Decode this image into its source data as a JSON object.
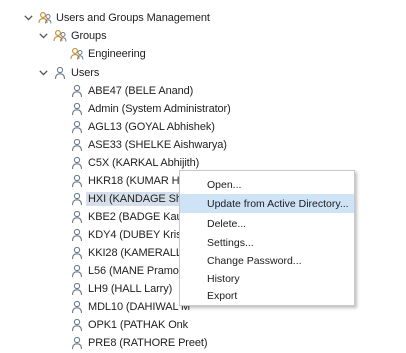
{
  "tree": {
    "root": {
      "label": "Users and Groups Management",
      "icon": "users-groups-icon",
      "expanded": true
    },
    "groups": {
      "label": "Groups",
      "icon": "group-icon",
      "expanded": true
    },
    "group_items": [
      {
        "label": "Engineering",
        "icon": "group-icon"
      }
    ],
    "users": {
      "label": "Users",
      "icon": "user-icon",
      "expanded": true
    },
    "user_items": [
      {
        "label": "ABE47 (BELE Anand)"
      },
      {
        "label": "Admin (System Administrator)"
      },
      {
        "label": "AGL13 (GOYAL Abhishek)"
      },
      {
        "label": "ASE33 (SHELKE Aishwarya)"
      },
      {
        "label": "C5X (KARKAL Abhijith)"
      },
      {
        "label": "HKR18 (KUMAR Himanshu)"
      },
      {
        "label": "HXI (KANDAGE Shail",
        "selected": true
      },
      {
        "label": "KBE2 (BADGE Kaustu"
      },
      {
        "label": "KDY4 (DUBEY Krishn"
      },
      {
        "label": "KKI28 (KAMERALLI K"
      },
      {
        "label": "L56 (MANE Pramod)"
      },
      {
        "label": "LH9 (HALL Larry)"
      },
      {
        "label": "MDL10 (DAHIWAL M"
      },
      {
        "label": "OPK1 (PATHAK Onk"
      },
      {
        "label": "PRE8 (RATHORE Preet)"
      }
    ]
  },
  "context_menu": {
    "items": [
      {
        "label": "Open..."
      },
      {
        "label": "Update from Active Directory...",
        "hover": true
      },
      {
        "label": "Delete..."
      },
      {
        "label": "Settings..."
      },
      {
        "label": "Change Password..."
      },
      {
        "label": "History"
      },
      {
        "label": "Export"
      }
    ]
  },
  "colors": {
    "selection": "#d5dfec",
    "menu_hover": "#cfe3f7",
    "user_icon": "#6d7b8a",
    "group_icon": "#c48a2a"
  }
}
